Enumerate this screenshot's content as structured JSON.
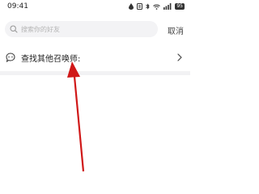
{
  "status_bar": {
    "time": "09:41",
    "icons": [
      "drop-icon",
      "notification-icon",
      "wifi-icon",
      "bluetooth-icon",
      "signal-icon",
      "battery-icon"
    ],
    "battery_percent": "95"
  },
  "search": {
    "placeholder": "搜索你的好友",
    "value": "",
    "cancel_label": "取消"
  },
  "find_row": {
    "icon": "chat-bubble-icon",
    "label": "查找其他召唤师:"
  },
  "colors": {
    "background": "#ffffff",
    "search_bg": "#f3f3f5",
    "band": "#f2f2f4",
    "arrow": "#d01818"
  }
}
